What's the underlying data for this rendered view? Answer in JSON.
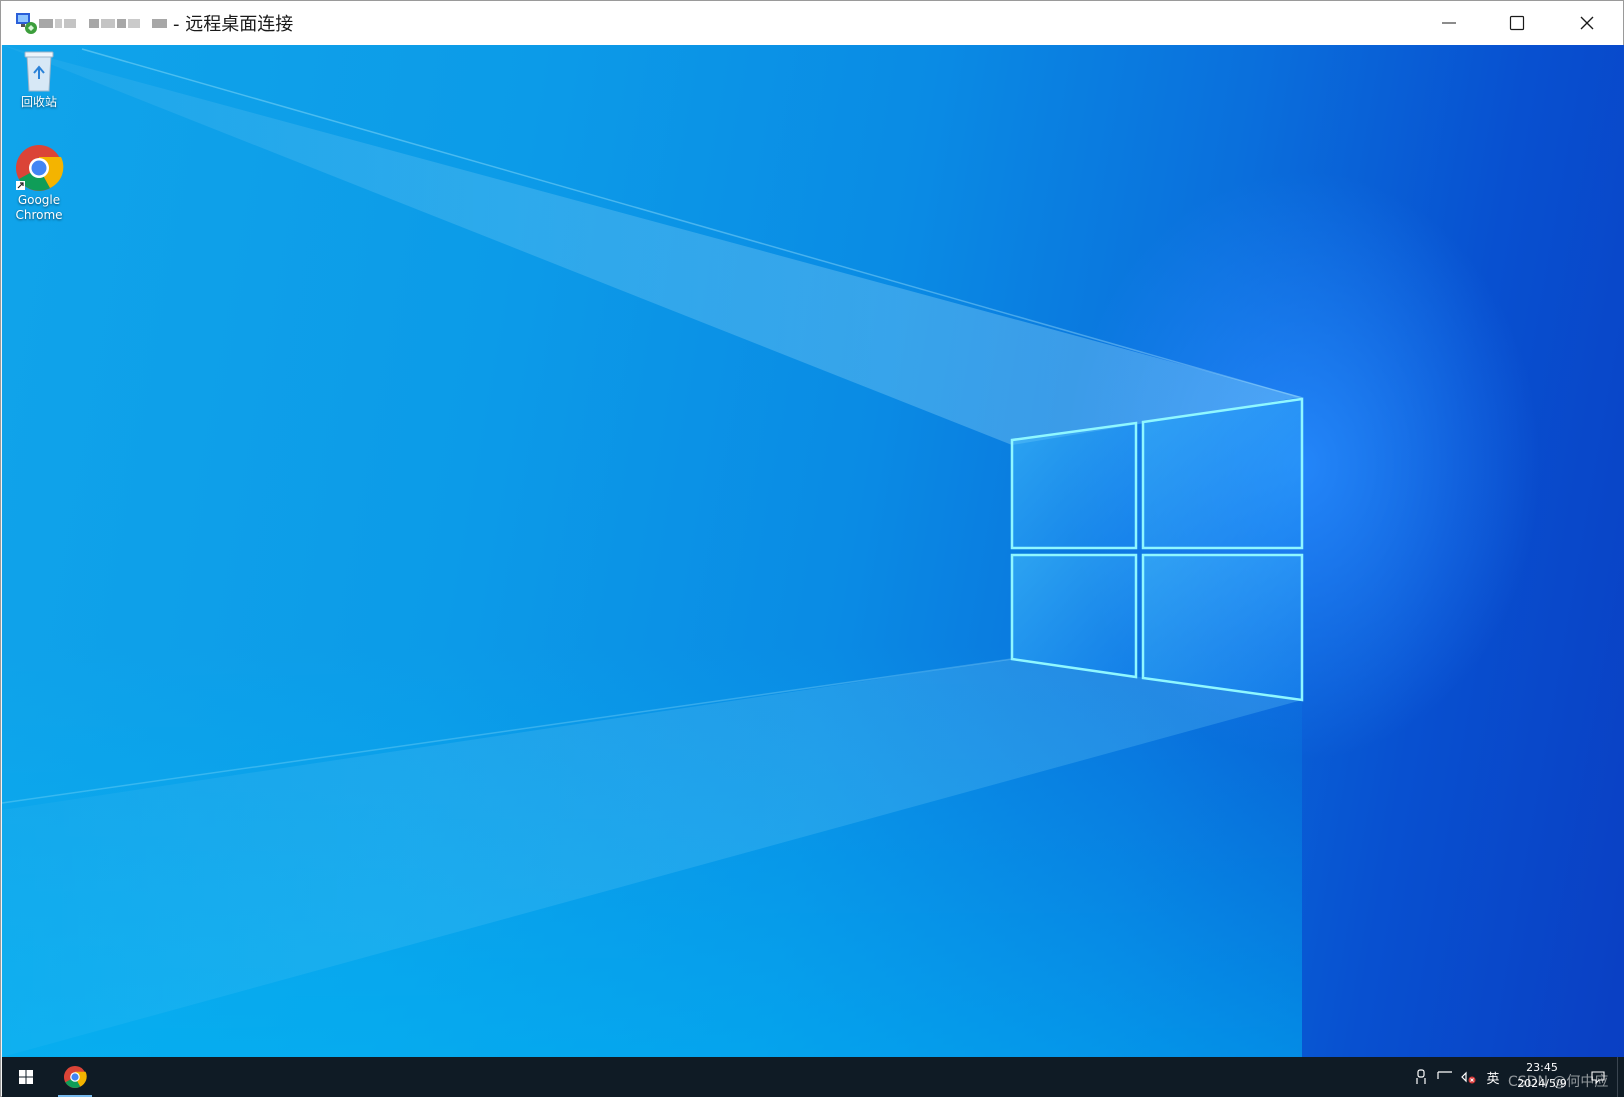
{
  "window": {
    "app_icon": "remote-desktop-icon",
    "title_suffix": "- 远程桌面连接",
    "controls": [
      "minimize-icon",
      "maximize-icon",
      "close-icon"
    ]
  },
  "desktop": {
    "wallpaper": "windows-10-hero",
    "icons": [
      {
        "label": "回收站",
        "icon": "recycle-bin-icon"
      },
      {
        "label": "Google Chrome",
        "icon": "chrome-icon"
      }
    ]
  },
  "taskbar": {
    "start_icon": "windows-start-icon",
    "pinned": [
      {
        "icon": "chrome-icon",
        "active": true
      }
    ],
    "tray": {
      "language": "英",
      "time": "23:45",
      "date": "2024/5/9"
    },
    "watermark": "CSDN @何中应"
  },
  "colors": {
    "taskbar": "#0f1b25",
    "desktop_light": "#10a4ea",
    "desktop_dark": "#0a3fc3",
    "logo_glow": "#7ff3ff"
  }
}
